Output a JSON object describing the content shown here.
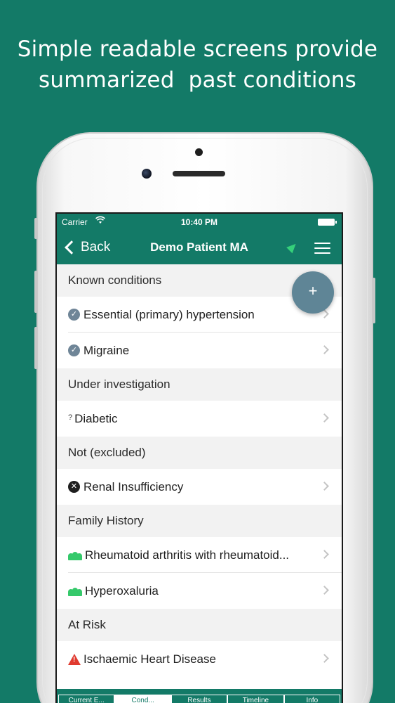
{
  "headline": {
    "line1": "Simple readable screens provide",
    "line2": "summarized  past conditions"
  },
  "status_bar": {
    "carrier": "Carrier",
    "wifi_icon": "wifi-icon",
    "time": "10:40 PM",
    "battery_icon": "battery-icon"
  },
  "nav": {
    "back_label": "Back",
    "title": "Demo Patient MA",
    "location_icon": "location-arrow-icon",
    "menu_icon": "hamburger-menu-icon"
  },
  "fab": {
    "label": "+"
  },
  "sections": [
    {
      "title": "Known conditions",
      "items": [
        {
          "label": "Essential (primary) hypertension",
          "icon": "check-circle-icon"
        },
        {
          "label": "Migraine",
          "icon": "check-circle-icon"
        }
      ]
    },
    {
      "title": "Under investigation",
      "items": [
        {
          "label": "Diabetic",
          "icon": "question-icon",
          "icon_glyph": "?"
        }
      ]
    },
    {
      "title": "Not (excluded)",
      "items": [
        {
          "label": "Renal Insufficiency",
          "icon": "x-circle-icon"
        }
      ]
    },
    {
      "title": "Family History",
      "items": [
        {
          "label": "Rheumatoid arthritis with rheumatoid...",
          "icon": "family-icon"
        },
        {
          "label": "Hyperoxaluria",
          "icon": "family-icon"
        }
      ]
    },
    {
      "title": "At Risk",
      "items": [
        {
          "label": "Ischaemic Heart Disease",
          "icon": "warning-icon"
        }
      ]
    }
  ],
  "tabbar": {
    "tabs": [
      {
        "label": "Current E..."
      },
      {
        "label": "Cond..."
      },
      {
        "label": "Results"
      },
      {
        "label": "Timeline"
      },
      {
        "label": "Info"
      }
    ],
    "active_index": 1
  },
  "colors": {
    "background": "#137a67",
    "nav_bar": "#137a67",
    "fab": "#5f8596",
    "check_icon": "#6f8597",
    "family_icon": "#35c96b",
    "warning_icon": "#e03a2f",
    "section_bg": "#f2f2f2"
  }
}
